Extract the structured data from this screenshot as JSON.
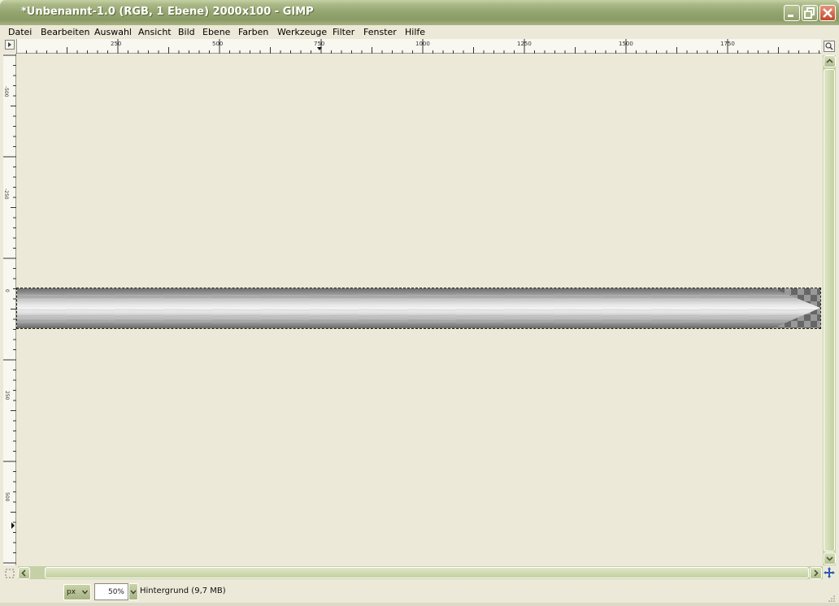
{
  "window": {
    "title": "*Unbenannt-1.0 (RGB, 1 Ebene) 2000x100 - GIMP"
  },
  "menubar": {
    "items": [
      "Datei",
      "Bearbeiten",
      "Auswahl",
      "Ansicht",
      "Bild",
      "Ebene",
      "Farben",
      "Werkzeuge",
      "Filter",
      "Fenster",
      "Hilfe"
    ]
  },
  "rulers": {
    "horizontal_labels": [
      "250",
      "500",
      "750",
      "1000",
      "1250",
      "1500",
      "1750"
    ],
    "vertical_labels": [
      "-500",
      "-250",
      "0",
      "250",
      "500"
    ]
  },
  "statusbar": {
    "unit": "px",
    "zoom": "50%",
    "message": "Hintergrund (9,7 MB)"
  },
  "colors": {
    "titlebar": "#94a46e",
    "workspace": "#ece9d8",
    "scrollbar": "#c6d0a6",
    "close_button": "#c2482a"
  },
  "icons": {
    "window_minimize": "minimize-icon",
    "window_restore": "restore-icon",
    "window_close": "close-icon",
    "ruler_corner": "menu-arrow-icon",
    "zoom_toggle": "zoom-icon",
    "quick_mask": "quick-mask-icon",
    "navigate": "navigate-cross-icon"
  }
}
